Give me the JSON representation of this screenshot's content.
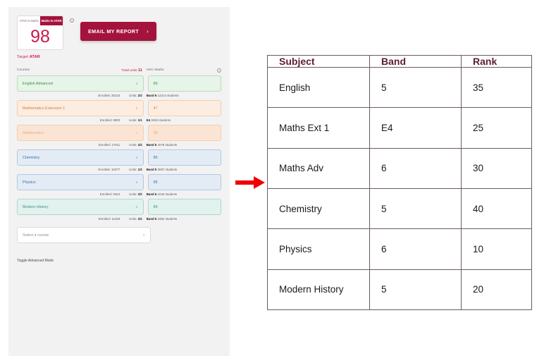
{
  "calculator": {
    "atar_card": {
      "toggle_left_label": "ATAR to Marks",
      "toggle_right_label": "Marks to ATAR",
      "value": "98",
      "caption_prefix": "Target ",
      "caption_strong": "ATAR",
      "info_icon": "info-icon",
      "info_glyph": "i"
    },
    "email_button": {
      "label": "EMAIL MY REPORT",
      "chevron": "›"
    },
    "column_headers": {
      "courses": "Courses",
      "total_units_label": "Total units",
      "total_units_value": "11",
      "hsc_marks": "HSC Marks",
      "marks_info_glyph": "i"
    },
    "caret_glyph": "∨",
    "add_course_placeholder": "Select a course",
    "toggle_advanced_label": "Toggle Advanced Mode",
    "courses": [
      {
        "name": "English Advanced",
        "mark": "89",
        "enrolled_label": "Enrolled:",
        "enrolled_value": "25233",
        "units_label": "Units:",
        "units_value": "2/2",
        "band": "Band 6",
        "band_students": "12214 students",
        "theme": "theme-green"
      },
      {
        "name": "Mathematics Extension 1",
        "mark": "47",
        "enrolled_label": "Enrolled:",
        "enrolled_value": "8800",
        "units_label": "Units:",
        "units_value": "1/1",
        "band": "E4",
        "band_students": "3453 students",
        "theme": "theme-orange"
      },
      {
        "name": "Mathematics",
        "mark": "98",
        "enrolled_label": "Enrolled:",
        "enrolled_value": "17011",
        "units_label": "Units:",
        "units_value": "2/2",
        "band": "Band 6",
        "band_students": "4078 students",
        "theme": "theme-orange-faded"
      },
      {
        "name": "Chemistry",
        "mark": "85",
        "enrolled_label": "Enrolled:",
        "enrolled_value": "10277",
        "units_label": "Units:",
        "units_value": "1/2",
        "band": "Band 5",
        "band_students": "3087 students",
        "theme": "theme-blue"
      },
      {
        "name": "Physics",
        "mark": "95",
        "enrolled_label": "Enrolled:",
        "enrolled_value": "9404",
        "units_label": "Units:",
        "units_value": "2/2",
        "band": "Band 6",
        "band_students": "1043 students",
        "theme": "theme-blue"
      },
      {
        "name": "Modern History",
        "mark": "89",
        "enrolled_label": "Enrolled:",
        "enrolled_value": "11329",
        "units_label": "Units:",
        "units_value": "2/2",
        "band": "Band 5",
        "band_students": "3382 students",
        "theme": "theme-teal"
      }
    ]
  },
  "arrow": {
    "icon": "right-arrow-icon",
    "color": "#f00000"
  },
  "results_table": {
    "columns": [
      "Subject",
      "Band",
      "Rank"
    ],
    "rows": [
      [
        "English",
        "5",
        "35"
      ],
      [
        "Maths Ext 1",
        "E4",
        "25"
      ],
      [
        "Maths Adv",
        "6",
        "30"
      ],
      [
        "Chemistry",
        "5",
        "40"
      ],
      [
        "Physics",
        "6",
        "10"
      ],
      [
        "Modern History",
        "5",
        "20"
      ]
    ]
  }
}
